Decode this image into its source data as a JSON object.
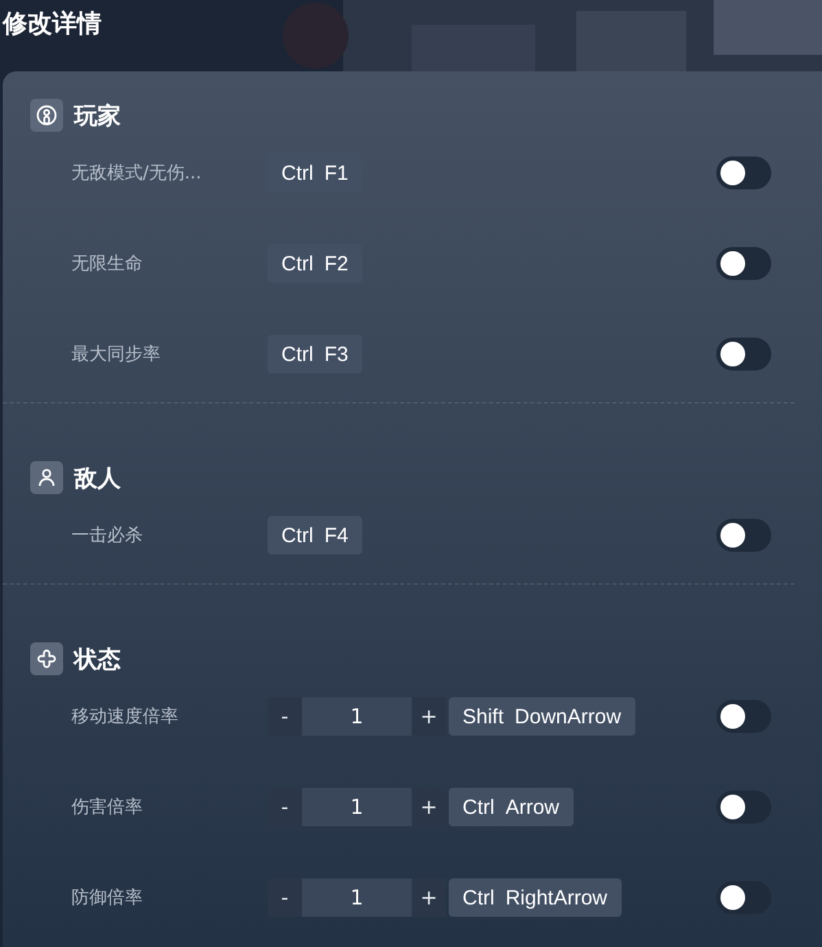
{
  "title": "修改详情",
  "sections": [
    {
      "name": "玩家",
      "items": [
        {
          "kind": "toggle",
          "label": "无敌模式/无伤...",
          "keys": [
            "Ctrl",
            "F1"
          ],
          "on": false
        },
        {
          "kind": "toggle",
          "label": "无限生命",
          "keys": [
            "Ctrl",
            "F2"
          ],
          "on": false
        },
        {
          "kind": "toggle",
          "label": "最大同步率",
          "keys": [
            "Ctrl",
            "F3"
          ],
          "on": false
        }
      ]
    },
    {
      "name": "敌人",
      "items": [
        {
          "kind": "toggle",
          "label": "一击必杀",
          "keys": [
            "Ctrl",
            "F4"
          ],
          "on": false
        }
      ]
    },
    {
      "name": "状态",
      "items": [
        {
          "kind": "stepper",
          "label": "移动速度倍率",
          "minus": "-",
          "value": "1",
          "plus": "+",
          "keys": [
            "Shift",
            "DownArrow"
          ],
          "on": false
        },
        {
          "kind": "stepper",
          "label": "伤害倍率",
          "minus": "-",
          "value": "1",
          "plus": "+",
          "keys": [
            "Ctrl",
            "Arrow"
          ],
          "on": false
        },
        {
          "kind": "stepper",
          "label": "防御倍率",
          "minus": "-",
          "value": "1",
          "plus": "+",
          "keys": [
            "Ctrl",
            "RightArrow"
          ],
          "on": false
        }
      ]
    }
  ]
}
